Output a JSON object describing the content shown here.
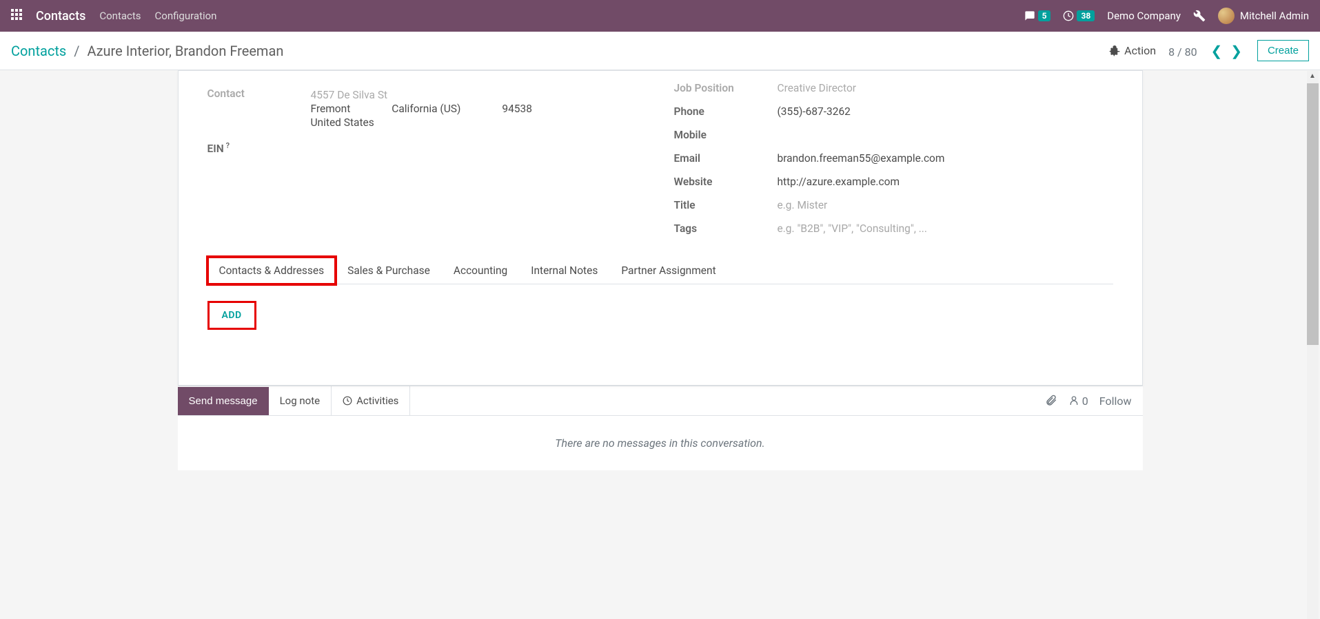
{
  "topbar": {
    "app_title": "Contacts",
    "menu": {
      "contacts": "Contacts",
      "configuration": "Configuration"
    },
    "msg_badge": "5",
    "clock_badge": "38",
    "company": "Demo Company",
    "user": "Mitchell Admin"
  },
  "breadcrumb": {
    "root": "Contacts",
    "current": "Azure Interior, Brandon Freeman"
  },
  "actions": {
    "action_label": "Action",
    "pager": "8 / 80",
    "create_label": "Create"
  },
  "form": {
    "contact_label": "Contact",
    "address": {
      "street": "4557 De Silva St",
      "city": "Fremont",
      "state": "California (US)",
      "zip": "94538",
      "country": "United States"
    },
    "ein_label": "EIN",
    "ein_help": "?",
    "job_position_label": "Job Position",
    "job_position_value": "Creative Director",
    "phone_label": "Phone",
    "phone_value": "(355)-687-3262",
    "mobile_label": "Mobile",
    "email_label": "Email",
    "email_value": "brandon.freeman55@example.com",
    "website_label": "Website",
    "website_value": "http://azure.example.com",
    "title_label": "Title",
    "title_placeholder": "e.g. Mister",
    "tags_label": "Tags",
    "tags_placeholder": "e.g. \"B2B\", \"VIP\", \"Consulting\", ..."
  },
  "tabs": {
    "contacts_addresses": "Contacts & Addresses",
    "sales_purchase": "Sales & Purchase",
    "accounting": "Accounting",
    "internal_notes": "Internal Notes",
    "partner_assignment": "Partner Assignment"
  },
  "tab_content": {
    "add_label": "ADD"
  },
  "chatter": {
    "send_message": "Send message",
    "log_note": "Log note",
    "activities": "Activities",
    "followers_count": "0",
    "follow": "Follow",
    "no_messages": "There are no messages in this conversation."
  }
}
